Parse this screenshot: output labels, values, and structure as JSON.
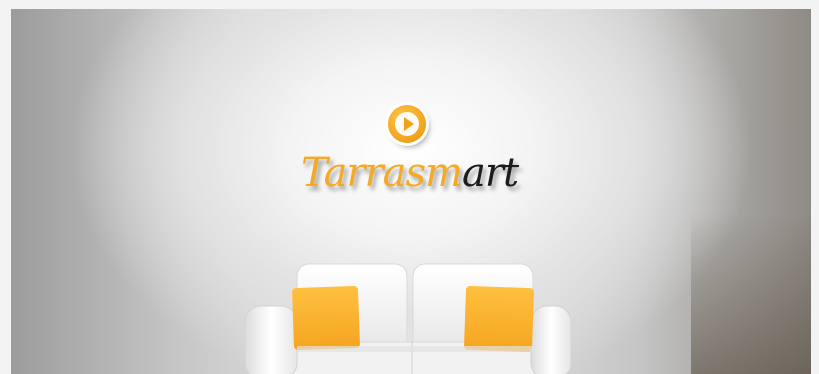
{
  "brand": {
    "name_part1": "Tarrasm",
    "name_part2": "art",
    "logo_icon": "play-icon"
  },
  "colors": {
    "brand_orange": "#f4aa24",
    "brand_dark": "#1c1c1c",
    "cushion": "#ffb62e",
    "sofa": "#f7f7f7"
  },
  "scene": {
    "furniture_icon": "sofa-icon"
  }
}
